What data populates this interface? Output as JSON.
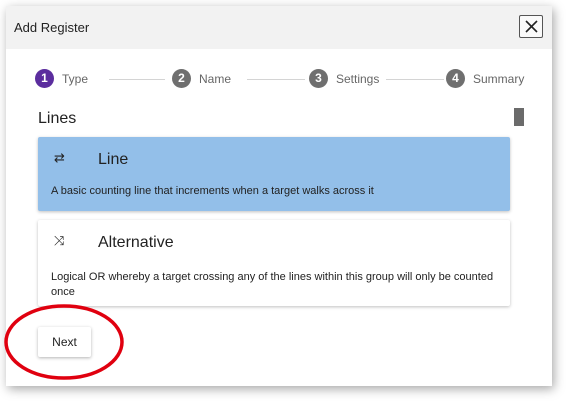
{
  "dialog": {
    "title": "Add Register",
    "close_icon": "close-icon"
  },
  "stepper": {
    "steps": [
      {
        "number": "1",
        "label": "Type",
        "active": true
      },
      {
        "number": "2",
        "label": "Name",
        "active": false
      },
      {
        "number": "3",
        "label": "Settings",
        "active": false
      },
      {
        "number": "4",
        "label": "Summary",
        "active": false
      }
    ]
  },
  "section": {
    "title": "Lines"
  },
  "options": [
    {
      "icon": "arrows-exchange-icon",
      "glyph": "⇄",
      "title": "Line",
      "description": "A basic counting line that increments when a target walks across it",
      "selected": true
    },
    {
      "icon": "shuffle-icon",
      "glyph": "⤨",
      "title": "Alternative",
      "description": "Logical OR whereby a target crossing any of the lines within this group will only be counted once",
      "selected": false
    }
  ],
  "actions": {
    "next_label": "Next"
  },
  "colors": {
    "accent": "#5b2d9e",
    "selected_card": "#93bfe9",
    "annotation_circle": "#e0000f"
  }
}
